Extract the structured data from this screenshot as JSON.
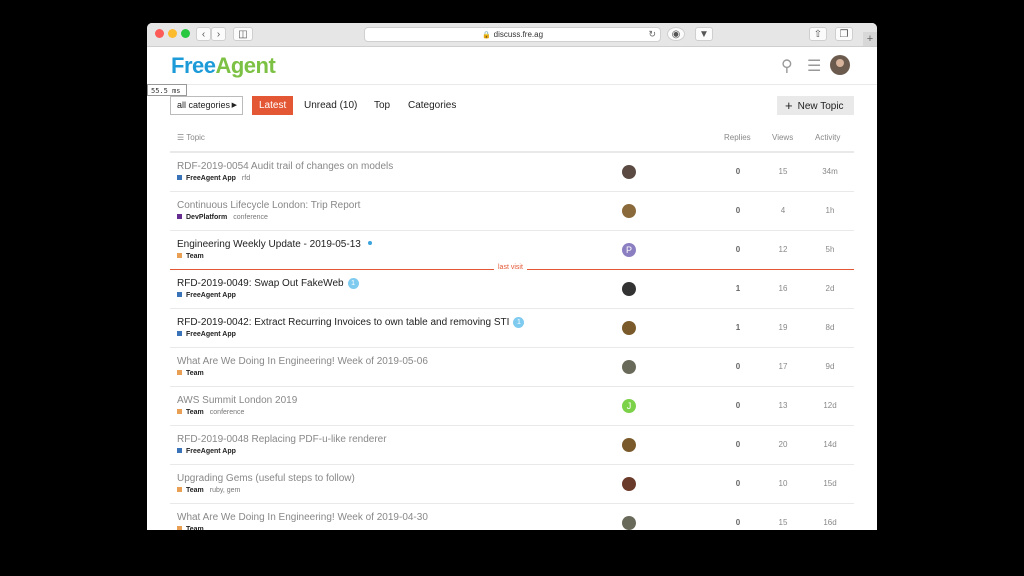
{
  "browser": {
    "url": "discuss.fre.ag",
    "back_icon": "chevron-left-icon",
    "forward_icon": "chevron-right-icon",
    "reload_icon": "reload-icon"
  },
  "header": {
    "logo_part1": "Free",
    "logo_part2": "Agent",
    "brand_blue": "#1c9bd8",
    "brand_green": "#7cc143"
  },
  "timing": "55.5 ms",
  "nav": {
    "category_dropdown": "all categories",
    "tabs": [
      "Latest",
      "Unread (10)",
      "Top",
      "Categories"
    ],
    "new_topic": "New Topic",
    "accent": "#e45735"
  },
  "table": {
    "headers": {
      "topic": "Topic",
      "replies": "Replies",
      "views": "Views",
      "activity": "Activity"
    },
    "last_visit_label": "last visit",
    "rows": [
      {
        "title": "RDF-2019-0054 Audit trail of changes on models",
        "category": "FreeAgent App",
        "cat_color": "#3b73b9",
        "tags": "rfd",
        "replies": "0",
        "views": "15",
        "activity": "34m",
        "unread": false,
        "badge": "",
        "new": false,
        "avatar_color": "#5a4a42",
        "avatar_letter": ""
      },
      {
        "title": "Continuous Lifecycle London: Trip Report",
        "category": "DevPlatform",
        "cat_color": "#652d90",
        "tags": "conference",
        "replies": "0",
        "views": "4",
        "activity": "1h",
        "unread": false,
        "badge": "",
        "new": false,
        "avatar_color": "#8a6a3a",
        "avatar_letter": ""
      },
      {
        "title": "Engineering Weekly Update - 2019-05-13",
        "category": "Team",
        "cat_color": "#e9a055",
        "tags": "",
        "replies": "0",
        "views": "12",
        "activity": "5h",
        "unread": true,
        "badge": "",
        "new": true,
        "avatar_color": "#8c7fc1",
        "avatar_letter": "P"
      },
      {
        "title": "RFD-2019-0049: Swap Out FakeWeb",
        "category": "FreeAgent App",
        "cat_color": "#3b73b9",
        "tags": "",
        "replies": "1",
        "views": "16",
        "activity": "2d",
        "unread": true,
        "badge": "1",
        "new": false,
        "avatar_color": "#333333",
        "avatar_letter": ""
      },
      {
        "title": "RFD-2019-0042: Extract Recurring Invoices to own table and removing STI",
        "category": "FreeAgent App",
        "cat_color": "#3b73b9",
        "tags": "",
        "replies": "1",
        "views": "19",
        "activity": "8d",
        "unread": true,
        "badge": "1",
        "new": false,
        "avatar_color": "#7a5a2a",
        "avatar_letter": ""
      },
      {
        "title": "What Are We Doing In Engineering! Week of 2019-05-06",
        "category": "Team",
        "cat_color": "#e9a055",
        "tags": "",
        "replies": "0",
        "views": "17",
        "activity": "9d",
        "unread": false,
        "badge": "",
        "new": false,
        "avatar_color": "#6a6a5a",
        "avatar_letter": ""
      },
      {
        "title": "AWS Summit London 2019",
        "category": "Team",
        "cat_color": "#e9a055",
        "tags": "conference",
        "replies": "0",
        "views": "13",
        "activity": "12d",
        "unread": false,
        "badge": "",
        "new": false,
        "avatar_color": "#7bd148",
        "avatar_letter": "J"
      },
      {
        "title": "RFD-2019-0048 Replacing PDF-u-like renderer",
        "category": "FreeAgent App",
        "cat_color": "#3b73b9",
        "tags": "",
        "replies": "0",
        "views": "20",
        "activity": "14d",
        "unread": false,
        "badge": "",
        "new": false,
        "avatar_color": "#7a5a2a",
        "avatar_letter": ""
      },
      {
        "title": "Upgrading Gems (useful steps to follow)",
        "category": "Team",
        "cat_color": "#e9a055",
        "tags": "ruby, gem",
        "replies": "0",
        "views": "10",
        "activity": "15d",
        "unread": false,
        "badge": "",
        "new": false,
        "avatar_color": "#6a3a2a",
        "avatar_letter": ""
      },
      {
        "title": "What Are We Doing In Engineering! Week of 2019-04-30",
        "category": "Team",
        "cat_color": "#e9a055",
        "tags": "",
        "replies": "0",
        "views": "15",
        "activity": "16d",
        "unread": false,
        "badge": "",
        "new": false,
        "avatar_color": "#6a6a5a",
        "avatar_letter": ""
      }
    ]
  }
}
